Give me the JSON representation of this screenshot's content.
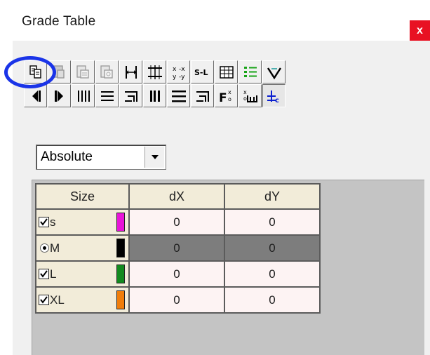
{
  "window": {
    "title": "Grade Table",
    "close_label": "x"
  },
  "toolbar": {
    "row1": [
      {
        "icon": "copy-icon",
        "enabled": true
      },
      {
        "icon": "paste-icon",
        "enabled": false
      },
      {
        "icon": "paste-special-icon",
        "enabled": false
      },
      {
        "icon": "paste-values-icon",
        "enabled": false
      },
      {
        "icon": "insert-column-icon",
        "enabled": true
      },
      {
        "icon": "insert-row-icon",
        "enabled": true
      },
      {
        "icon": "swap-xy-icon",
        "enabled": true
      },
      {
        "icon": "s-to-l-icon",
        "label": "S-L",
        "enabled": true
      },
      {
        "icon": "table-icon",
        "enabled": true
      },
      {
        "icon": "list-icon",
        "enabled": true
      },
      {
        "icon": "checkmark-icon",
        "enabled": true
      }
    ],
    "row2": [
      {
        "icon": "previous-icon",
        "enabled": true
      },
      {
        "icon": "next-icon",
        "enabled": true
      },
      {
        "icon": "vertical-lines-icon",
        "enabled": true
      },
      {
        "icon": "horizontal-lines-icon",
        "enabled": true
      },
      {
        "icon": "align-right-icon",
        "enabled": true
      },
      {
        "icon": "thick-vertical-lines-icon",
        "enabled": true
      },
      {
        "icon": "thick-horizontal-lines-icon",
        "enabled": true
      },
      {
        "icon": "align-right-alt-icon",
        "enabled": true
      },
      {
        "icon": "format-icon",
        "enabled": true
      },
      {
        "icon": "measure-icon",
        "enabled": true
      },
      {
        "icon": "grade-rule-icon",
        "enabled": true,
        "pressed": true
      }
    ]
  },
  "mode_select": {
    "value": "Absolute"
  },
  "grade_table": {
    "columns": [
      "Size",
      "dX",
      "dY"
    ],
    "rows": [
      {
        "size": "s",
        "control": "checkbox",
        "checked": true,
        "color": "#e815d8",
        "dx": "0",
        "dy": "0",
        "selected": false
      },
      {
        "size": "M",
        "control": "radio",
        "checked": true,
        "color": "#000000",
        "dx": "0",
        "dy": "0",
        "selected": true
      },
      {
        "size": "L",
        "control": "checkbox",
        "checked": true,
        "color": "#138a1f",
        "dx": "0",
        "dy": "0",
        "selected": false
      },
      {
        "size": "XL",
        "control": "checkbox",
        "checked": true,
        "color": "#f07d0a",
        "dx": "0",
        "dy": "0",
        "selected": false
      }
    ]
  },
  "annotation": {
    "highlight_color": "#1a34e8"
  }
}
